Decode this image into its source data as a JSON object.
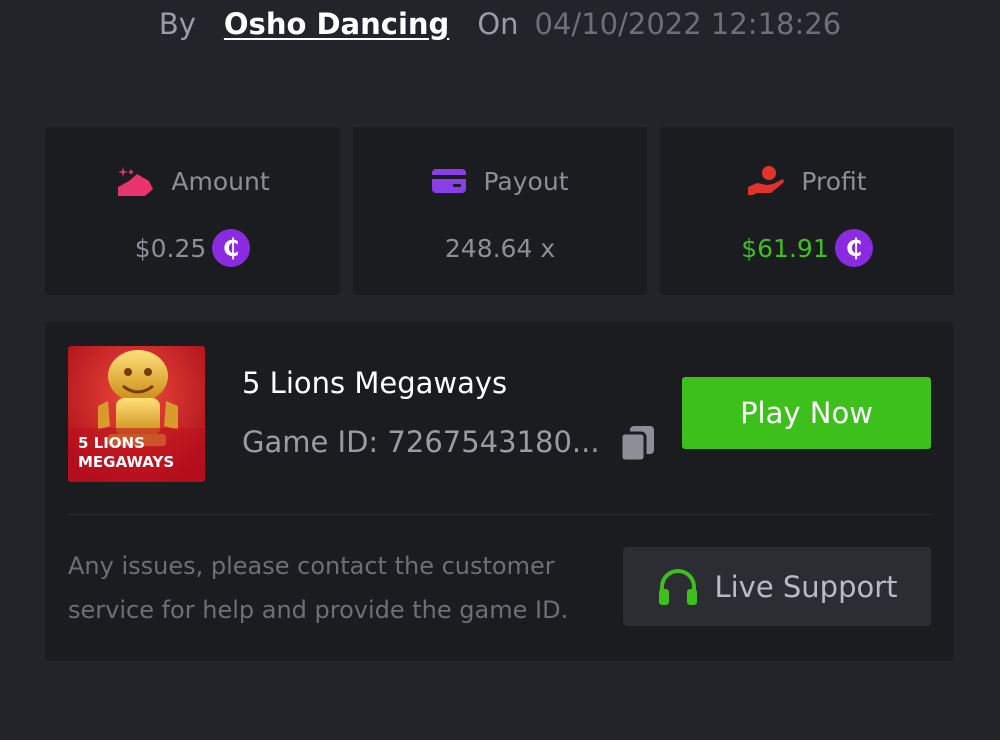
{
  "header": {
    "by_label": "By",
    "username": "Osho Dancing",
    "on_label": "On",
    "datetime": "04/10/2022 12:18:26"
  },
  "stats": {
    "amount": {
      "label": "Amount",
      "value": "$0.25",
      "icon": "amount-icon",
      "color": "#e8336e"
    },
    "payout": {
      "label": "Payout",
      "value": "248.64 x",
      "icon": "card-icon",
      "color": "#8a3ee8"
    },
    "profit": {
      "label": "Profit",
      "value": "$61.91",
      "icon": "hand-coin-icon",
      "color": "#e0332b",
      "value_color": "#3dbf1c"
    }
  },
  "currency": {
    "symbol": "₵",
    "color": "#8a2be2"
  },
  "game": {
    "title": "5 Lions Megaways",
    "id_text": "Game ID: 7267543180...",
    "thumbnail_line1": "5 LIONS",
    "thumbnail_line2": "MEGAWAYS",
    "play_label": "Play Now"
  },
  "support": {
    "note": "Any issues, please contact the customer service for help and provide the game ID.",
    "button_label": "Live Support",
    "icon": "headset-icon",
    "accent": "#3dbf1c"
  }
}
